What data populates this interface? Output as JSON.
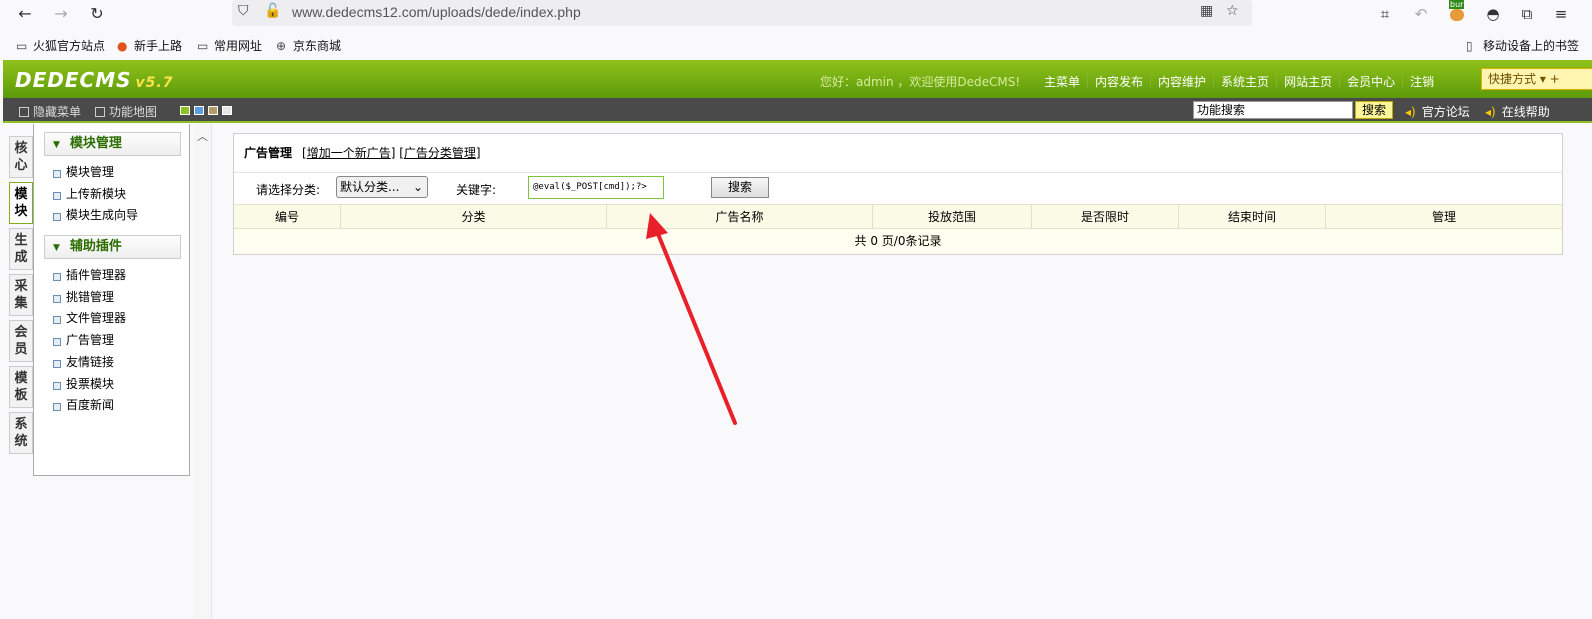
{
  "browser": {
    "url": "www.dedecms12.com/uploads/dede/index.php",
    "icons": [
      "back-arrow-icon",
      "forward-arrow-icon",
      "reload-icon",
      "shield-icon",
      "lock-warning-icon",
      "qr-code-icon",
      "star-icon",
      "crop-icon",
      "undo-icon",
      "burp-extension-icon",
      "hat-icon",
      "extensions-icon",
      "menu-icon"
    ],
    "extension_badge": "bur"
  },
  "bookmarks": {
    "items": [
      "火狐官方站点",
      "新手上路",
      "常用网址",
      "京东商城"
    ],
    "mobile": "移动设备上的书签"
  },
  "header": {
    "logo": "DEDECMS",
    "version": "v5.7",
    "welcome": "您好：admin ，欢迎使用DedeCMS!",
    "menu": [
      "主菜单",
      "内容发布",
      "内容维护",
      "系统主页",
      "网站主页",
      "会员中心",
      "注销"
    ],
    "quick": "快捷方式 ▾ +"
  },
  "toolbar": {
    "hide_menu": "隐藏菜单",
    "func_map": "功能地图",
    "search_placeholder": "功能搜索",
    "search_btn": "搜索",
    "forum": "官方论坛",
    "help": "在线帮助",
    "colors": [
      "#8ec221",
      "#5aa0e0",
      "#b59a6a",
      "#e6e6e6"
    ]
  },
  "left_tabs": [
    "核心",
    "模块",
    "生成",
    "采集",
    "会员",
    "模板",
    "系统"
  ],
  "left_menu": {
    "section1": "模块管理",
    "items1": [
      "模块管理",
      "上传新模块",
      "模块生成向导"
    ],
    "section2": "辅助插件",
    "items2": [
      "插件管理器",
      "挑错管理",
      "文件管理器",
      "广告管理",
      "友情链接",
      "投票模块",
      "百度新闻"
    ]
  },
  "main": {
    "title": "广告管理",
    "link_add": "增加一个新广告",
    "link_cat": "广告分类管理",
    "cat_label": "请选择分类:",
    "cat_value": "默认分类...",
    "kw_label": "关键字:",
    "kw_value": "@eval($_POST[cmd]);?>",
    "search_btn": "搜索",
    "columns": [
      "编号",
      "分类",
      "广告名称",
      "投放范围",
      "是否限时",
      "结束时间",
      "管理"
    ],
    "footer": "共 0 页/0条记录"
  },
  "annotation": {
    "color": "#e8202a"
  }
}
